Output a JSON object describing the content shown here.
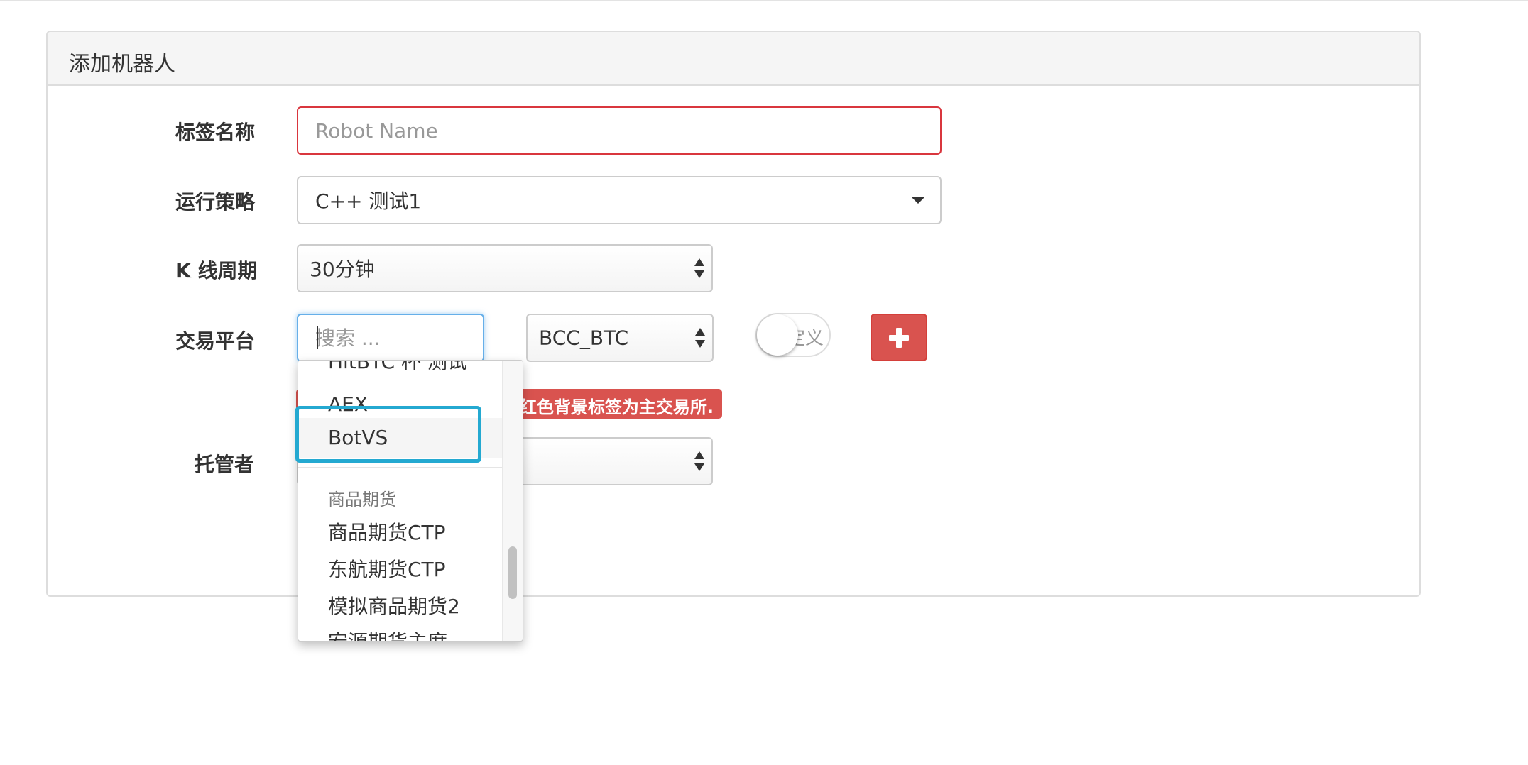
{
  "panel": {
    "title": "添加机器人"
  },
  "form": {
    "label_name": "标签名称",
    "name_placeholder": "Robot Name",
    "label_strategy": "运行策略",
    "strategy_value": "C++ 测试1",
    "label_kline": "K 线周期",
    "kline_value": "30分钟",
    "label_exchange": "交易平台",
    "exchange_search_placeholder": "搜索 ...",
    "pair_value": "BCC_BTC",
    "custom_toggle_label": "自定义",
    "add_button_icon": "plus-icon",
    "main_exchange_note": "红色背景标签为主交易所.",
    "label_host": "托管者"
  },
  "dropdown": {
    "items_top": [
      "HitBTC 杯 测试",
      "AEX",
      "BotVS"
    ],
    "group_header": "商品期货",
    "items_group": [
      "商品期货CTP",
      "东航期货CTP",
      "模拟商品期货2",
      "宏源期货主席"
    ],
    "highlighted": "BotVS"
  },
  "colors": {
    "error_border": "#d9363e",
    "danger": "#d9534f",
    "focus_border": "#66afe9",
    "annotation_highlight": "#24a9d1",
    "panel_heading_bg": "#f5f5f5"
  }
}
